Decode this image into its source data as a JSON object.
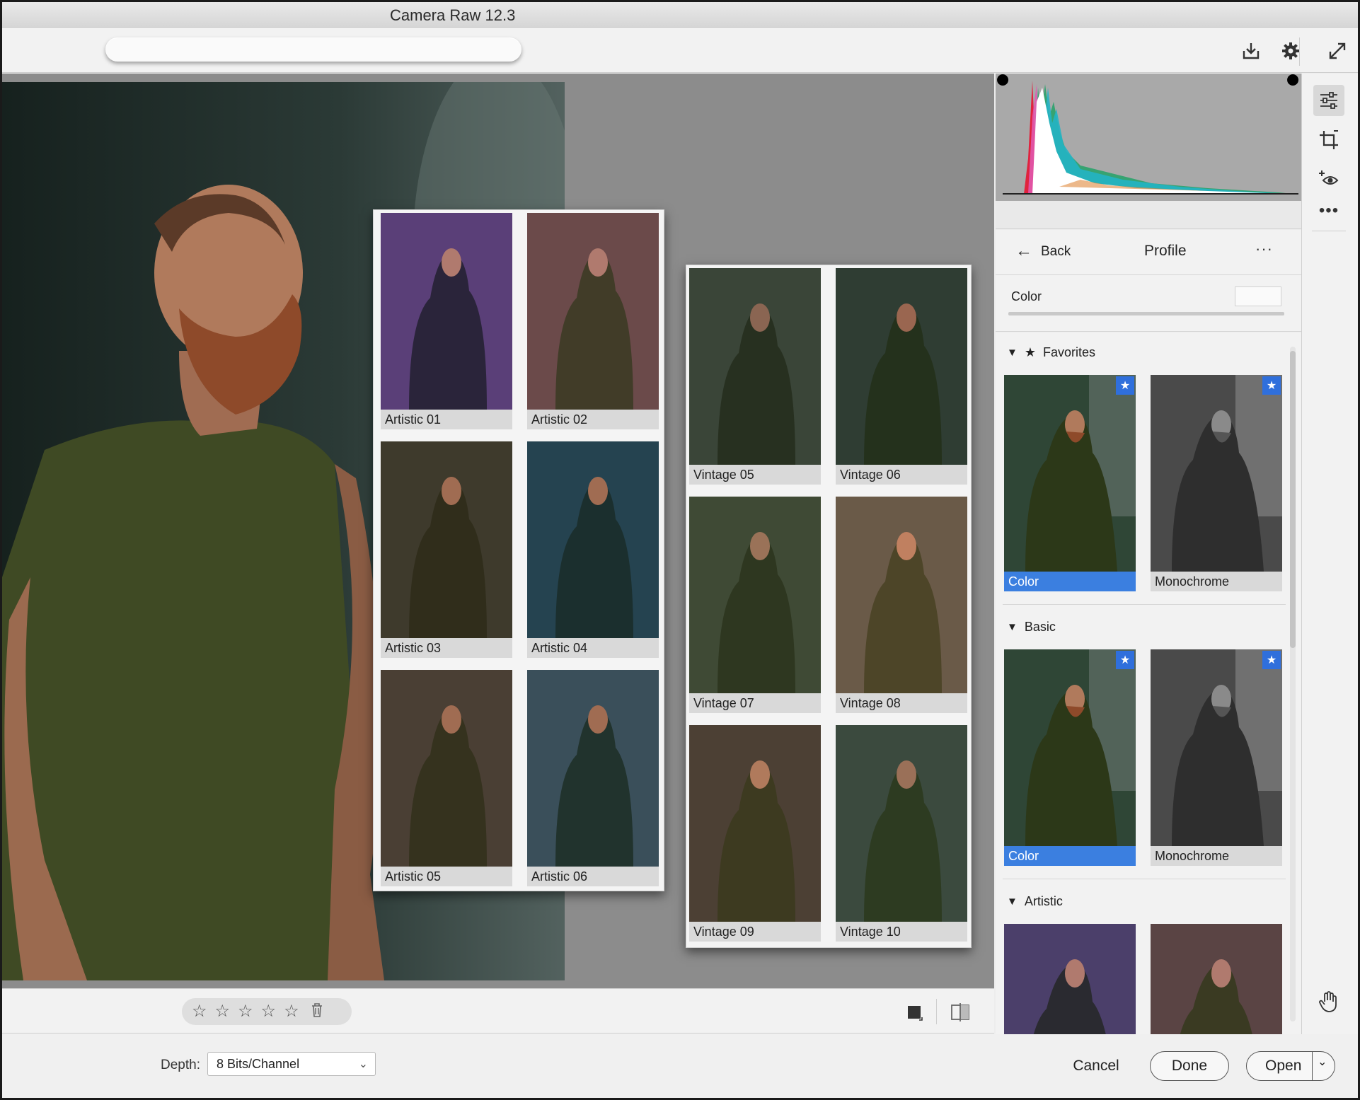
{
  "app": {
    "title": "Camera Raw 12.3"
  },
  "toolbar": {
    "search_value": ""
  },
  "popup_left": {
    "items": [
      {
        "label": "Artistic 01",
        "tint": "#5a3f78"
      },
      {
        "label": "Artistic 02",
        "tint": "#6b4a4a"
      },
      {
        "label": "Artistic 03",
        "tint": "#3e3a2c"
      },
      {
        "label": "Artistic 04",
        "tint": "#254350"
      },
      {
        "label": "Artistic 05",
        "tint": "#4a3f34"
      },
      {
        "label": "Artistic 06",
        "tint": "#3a4f5a"
      }
    ]
  },
  "popup_right": {
    "items": [
      {
        "label": "Vintage 05",
        "tint": "#3a4538"
      },
      {
        "label": "Vintage 06",
        "tint": "#2f3d33"
      },
      {
        "label": "Vintage 07",
        "tint": "#3f4a35"
      },
      {
        "label": "Vintage 08",
        "tint": "#6a5a48"
      },
      {
        "label": "Vintage 09",
        "tint": "#4c4034"
      },
      {
        "label": "Vintage 10",
        "tint": "#3b4a3e"
      }
    ]
  },
  "profile_panel": {
    "back_label": "Back",
    "title": "Profile",
    "color_label": "Color",
    "groups": [
      {
        "name": "Favorites",
        "items": [
          {
            "label": "Color",
            "selected": true,
            "favorite": true,
            "tint": "#2f4636"
          },
          {
            "label": "Monochrome",
            "selected": false,
            "favorite": true,
            "tint": "#4a4a4a"
          }
        ]
      },
      {
        "name": "Basic",
        "items": [
          {
            "label": "Color",
            "selected": true,
            "favorite": true,
            "tint": "#2f4636"
          },
          {
            "label": "Monochrome",
            "selected": false,
            "favorite": true,
            "tint": "#4a4a4a"
          }
        ]
      },
      {
        "name": "Artistic",
        "items": [
          {
            "label": "",
            "selected": false,
            "favorite": false,
            "tint": "#4b3f6a"
          },
          {
            "label": "",
            "selected": false,
            "favorite": false,
            "tint": "#5a4444"
          }
        ]
      }
    ]
  },
  "footer": {
    "depth_label": "Depth:",
    "depth_value": "8 Bits/Channel",
    "cancel_label": "Cancel",
    "done_label": "Done",
    "open_label": "Open"
  },
  "colors": {
    "accent": "#3b7fe0",
    "canvas_bg": "#8c8c8c",
    "panel_bg": "#f2f2f2",
    "histogram_bg": "#a9a9a9"
  },
  "icons": {
    "toolbar": [
      "save-download-icon",
      "gear-icon",
      "fullscreen-expand-icon"
    ],
    "rail": [
      "edit-sliders-icon",
      "crop-icon",
      "red-eye-heal-icon",
      "more-dots-icon",
      "hand-tool-icon"
    ],
    "canvas_bar": [
      "star-icon",
      "star-icon",
      "star-icon",
      "star-icon",
      "star-icon",
      "trash-icon",
      "view-mode-icon",
      "before-after-icon"
    ]
  }
}
